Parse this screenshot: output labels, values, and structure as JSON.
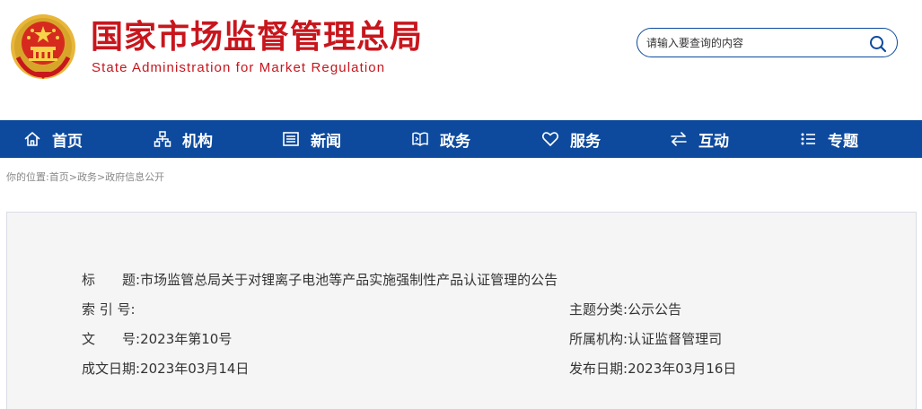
{
  "header": {
    "title": "国家市场监督管理总局",
    "subtitle": "State Administration for Market Regulation",
    "logo_icon": "national-emblem-icon"
  },
  "search": {
    "placeholder": "请输入要查询的内容",
    "icon": "search-icon"
  },
  "nav": {
    "items": [
      {
        "label": "首页",
        "icon": "home-icon"
      },
      {
        "label": "机构",
        "icon": "org-chart-icon"
      },
      {
        "label": "新闻",
        "icon": "news-icon"
      },
      {
        "label": "政务",
        "icon": "book-icon"
      },
      {
        "label": "服务",
        "icon": "heart-icon"
      },
      {
        "label": "互动",
        "icon": "arrows-exchange-icon"
      },
      {
        "label": "专题",
        "icon": "list-icon"
      }
    ]
  },
  "breadcrumb": {
    "prefix": "你的位置:",
    "links": [
      "首页",
      "政务",
      "政府信息公开"
    ],
    "separator": ">"
  },
  "doc_info": {
    "title_label": "标　　题:",
    "title_value": "市场监管总局关于对锂离子电池等产品实施强制性产品认证管理的公告",
    "index_label": "索 引 号:",
    "index_value": "",
    "topic_label": "主题分类:",
    "topic_value": "公示公告",
    "docno_label": "文　　号:",
    "docno_value": "2023年第10号",
    "dept_label": "所属机构:",
    "dept_value": "认证监督管理司",
    "written_label": "成文日期:",
    "written_value": "2023年03月14日",
    "publish_label": "发布日期:",
    "publish_value": "2023年03月16日"
  },
  "colors": {
    "brand_red": "#c8161d",
    "nav_blue": "#0d4a9e",
    "info_bg": "#f5f5f5"
  }
}
